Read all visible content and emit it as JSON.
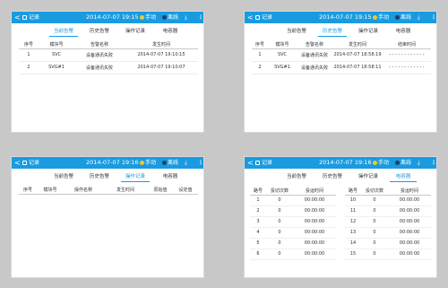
{
  "colors": {
    "accent": "#1a9be0",
    "mode_dot": "#e8c93a",
    "net_dot": "#1d3f66"
  },
  "icons": [
    "back-arrow-icon",
    "record-icon",
    "mode-indicator-icon",
    "network-indicator-icon",
    "download-icon",
    "more-icon"
  ],
  "panel1": {
    "topbar": {
      "back": "<",
      "title": "记录",
      "datetime": "2014-07-07 19:15",
      "mode": "手动",
      "network": "离线",
      "download": "⤓",
      "more": "⋮"
    },
    "tabs": [
      "当前告警",
      "历史告警",
      "操作记录",
      "电容器"
    ],
    "active_tab": 0,
    "headers": [
      "序号",
      "模块号",
      "告警名称",
      "发生时间"
    ],
    "rows": [
      [
        "1",
        "SVC",
        "设备通讯失败",
        "2014-07-07 19:10:15"
      ],
      [
        "2",
        "SVG#1",
        "设备通讯失败",
        "2014-07-07 19:10:07"
      ]
    ]
  },
  "panel2": {
    "topbar": {
      "back": "<",
      "title": "记录",
      "datetime": "2014-07-07 19:15",
      "mode": "手动",
      "network": "离线",
      "download": "⤓",
      "more": "⋮"
    },
    "tabs": [
      "当前告警",
      "历史告警",
      "操作记录",
      "电容器"
    ],
    "active_tab": 1,
    "headers": [
      "序号",
      "模块号",
      "告警名称",
      "发生时间",
      "结束时间"
    ],
    "rows": [
      [
        "1",
        "SVC",
        "设备通讯失败",
        "2014-07-07 18:58:19",
        "- - - - - - - - - - - -"
      ],
      [
        "2",
        "SVG#1",
        "设备通讯失败",
        "2014-07-07 18:58:11",
        "- - - - - - - - - - - -"
      ]
    ]
  },
  "panel3": {
    "topbar": {
      "back": "<",
      "title": "记录",
      "datetime": "2014-07-07 19:16",
      "mode": "手动",
      "network": "离线",
      "download": "⤓",
      "more": "⋮"
    },
    "tabs": [
      "当前告警",
      "历史告警",
      "操作记录",
      "电容器"
    ],
    "active_tab": 2,
    "headers": [
      "序号",
      "模块号",
      "操作名称",
      "发生时间",
      "原始值",
      "设定值"
    ]
  },
  "panel4": {
    "topbar": {
      "back": "<",
      "title": "记录",
      "datetime": "2014-07-07 19:16",
      "mode": "手动",
      "network": "离线",
      "download": "⤓",
      "more": "⋮"
    },
    "tabs": [
      "当前告警",
      "历史告警",
      "操作记录",
      "电容器"
    ],
    "active_tab": 3,
    "headers": [
      "路号",
      "投切次数",
      "投运时间"
    ],
    "left_rows": [
      [
        "1",
        "0",
        "00:00:00"
      ],
      [
        "2",
        "0",
        "00:00:00"
      ],
      [
        "3",
        "0",
        "00:00:00"
      ],
      [
        "4",
        "0",
        "00:00:00"
      ],
      [
        "5",
        "0",
        "00:00:00"
      ],
      [
        "6",
        "0",
        "00:00:00"
      ]
    ],
    "right_rows": [
      [
        "10",
        "0",
        "00:00:00"
      ],
      [
        "11",
        "0",
        "00:00:00"
      ],
      [
        "12",
        "0",
        "00:00:00"
      ],
      [
        "13",
        "0",
        "00:00:00"
      ],
      [
        "14",
        "0",
        "00:00:00"
      ],
      [
        "15",
        "0",
        "00:00:00"
      ]
    ]
  }
}
